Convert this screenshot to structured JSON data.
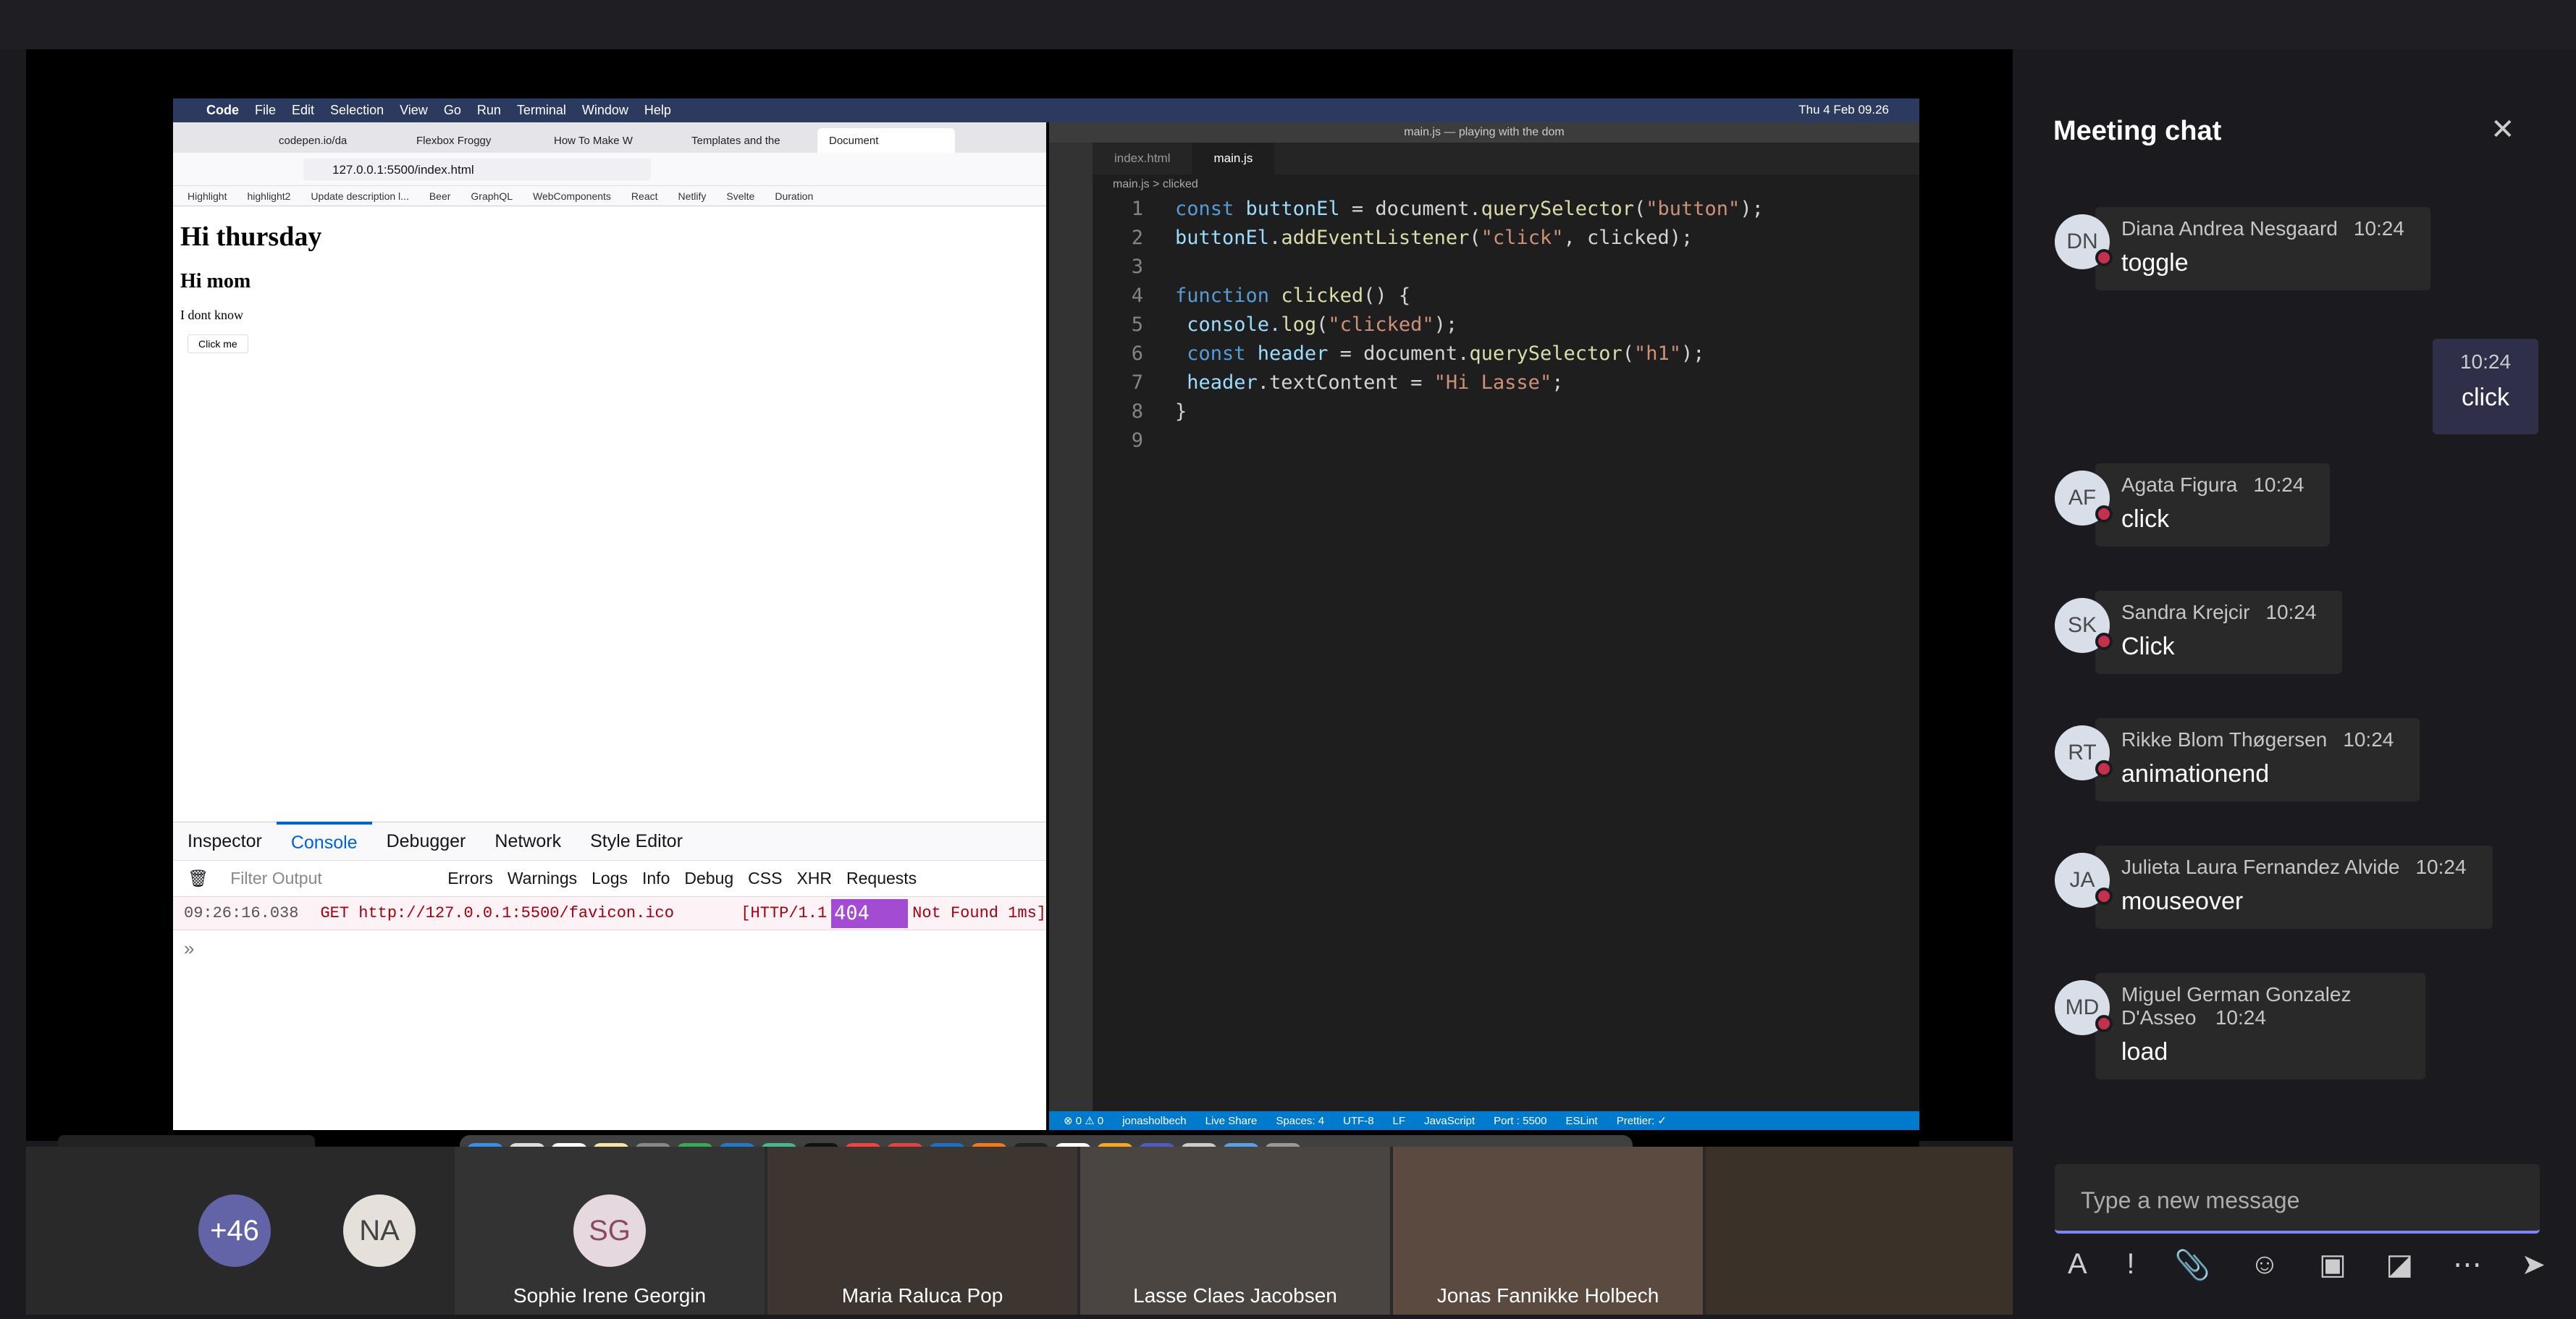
{
  "menubar": {
    "apple": "",
    "app": "Code",
    "items": [
      "File",
      "Edit",
      "Selection",
      "View",
      "Go",
      "Run",
      "Terminal",
      "Window",
      "Help"
    ],
    "clock": "Thu 4 Feb  09.26"
  },
  "firefox": {
    "tabs": [
      "codepen.io/da",
      "Flexbox Froggy",
      "How To Make W",
      "Templates and the",
      "Document"
    ],
    "url": "127.0.0.1:5500/index.html",
    "bookmarks": [
      "Highlight",
      "highlight2",
      "Update description l...",
      "Beer",
      "GraphQL",
      "WebComponents",
      "React",
      "Netlify",
      "Svelte",
      "Duration"
    ],
    "page": {
      "h1": "Hi thursday",
      "h2": "Hi mom",
      "p": "I dont know",
      "button": "Click me"
    },
    "devtools": {
      "tabs": [
        "Inspector",
        "Console",
        "Debugger",
        "Network",
        "Style Editor"
      ],
      "filter_placeholder": "Filter Output",
      "filters": [
        "Errors",
        "Warnings",
        "Logs",
        "Info",
        "Debug",
        "CSS",
        "XHR",
        "Requests"
      ],
      "log": {
        "time": "09:26:16.038",
        "method": "GET",
        "url": "http://127.0.0.1:5500/favicon.ico",
        "proto": "[HTTP/1.1",
        "code": "404",
        "status": "Not Found 1ms]"
      },
      "prompt": "»"
    }
  },
  "vscode": {
    "title": "main.js — playing with the dom",
    "tabs": [
      "index.html",
      "main.js"
    ],
    "breadcrumb": "main.js > clicked",
    "lines": [
      {
        "n": "1"
      },
      {
        "n": "2"
      },
      {
        "n": "3"
      },
      {
        "n": "4"
      },
      {
        "n": "5"
      },
      {
        "n": "6"
      },
      {
        "n": "7"
      },
      {
        "n": "8"
      },
      {
        "n": "9"
      }
    ],
    "code": {
      "l1a": "const ",
      "l1b": "buttonEl",
      " l1c": "",
      "l1d": " = document.",
      "l1e": "querySelector",
      "l1f": "(",
      "l1g": "\"button\"",
      "l1h": ");",
      "l2a": "buttonEl",
      "l2b": ".",
      "l2c": "addEventListener",
      "l2d": "(",
      "l2e": "\"click\"",
      "l2f": ", clicked);",
      "l4a": "function ",
      "l4b": "clicked",
      "l4c": "() {",
      "l5a": "  console.",
      "l5b": "log",
      "l5c": "(",
      "l5d": "\"clicked\"",
      "l5e": ");",
      "l6a": "  const ",
      "l6b": "header",
      "l6c": " = document.",
      "l6d": "querySelector",
      "l6e": "(",
      "l6f": "\"h1\"",
      "l6g": ");",
      "l7a": "  header",
      "l7b": ".textContent = ",
      "l7c": "\"Hi Lasse\"",
      "l7d": ";",
      "l8a": "}"
    },
    "status": [
      "⊗ 0 ⚠ 0",
      "jonasholbech",
      "Live Share",
      "Spaces: 4",
      "UTF-8",
      "LF",
      "JavaScript",
      "Port : 5500",
      "ESLint",
      "Prettier: ✓"
    ]
  },
  "presenter_label": "Jonas Fannikke Holbech",
  "participants": {
    "more": "+46",
    "na": "NA",
    "sg": "SG",
    "tiles": [
      "Sophie Irene Georgin",
      "Maria Raluca Pop",
      "Lasse Claes Jacobsen",
      "Jonas Fannikke Holbech"
    ]
  },
  "chat": {
    "title": "Meeting chat",
    "messages": [
      {
        "initials": "DN",
        "name": "Diana Andrea Nesgaard",
        "time": "10:24",
        "text": "toggle"
      },
      {
        "initials": "AF",
        "name": "Agata Figura",
        "time": "10:24",
        "text": "click"
      },
      {
        "initials": "SK",
        "name": "Sandra Krejcir",
        "time": "10:24",
        "text": "Click"
      },
      {
        "initials": "RT",
        "name": "Rikke Blom Thøgersen",
        "time": "10:24",
        "text": "animationend"
      },
      {
        "initials": "JA",
        "name": "Julieta Laura Fernandez Alvide",
        "time": "10:24",
        "text": "mouseover"
      },
      {
        "initials": "MD",
        "name": "Miguel German Gonzalez D'Asseo",
        "time": "10:24",
        "text": "load"
      }
    ],
    "mine": {
      "time": "10:24",
      "text": "click"
    },
    "compose_placeholder": "Type a new message"
  }
}
